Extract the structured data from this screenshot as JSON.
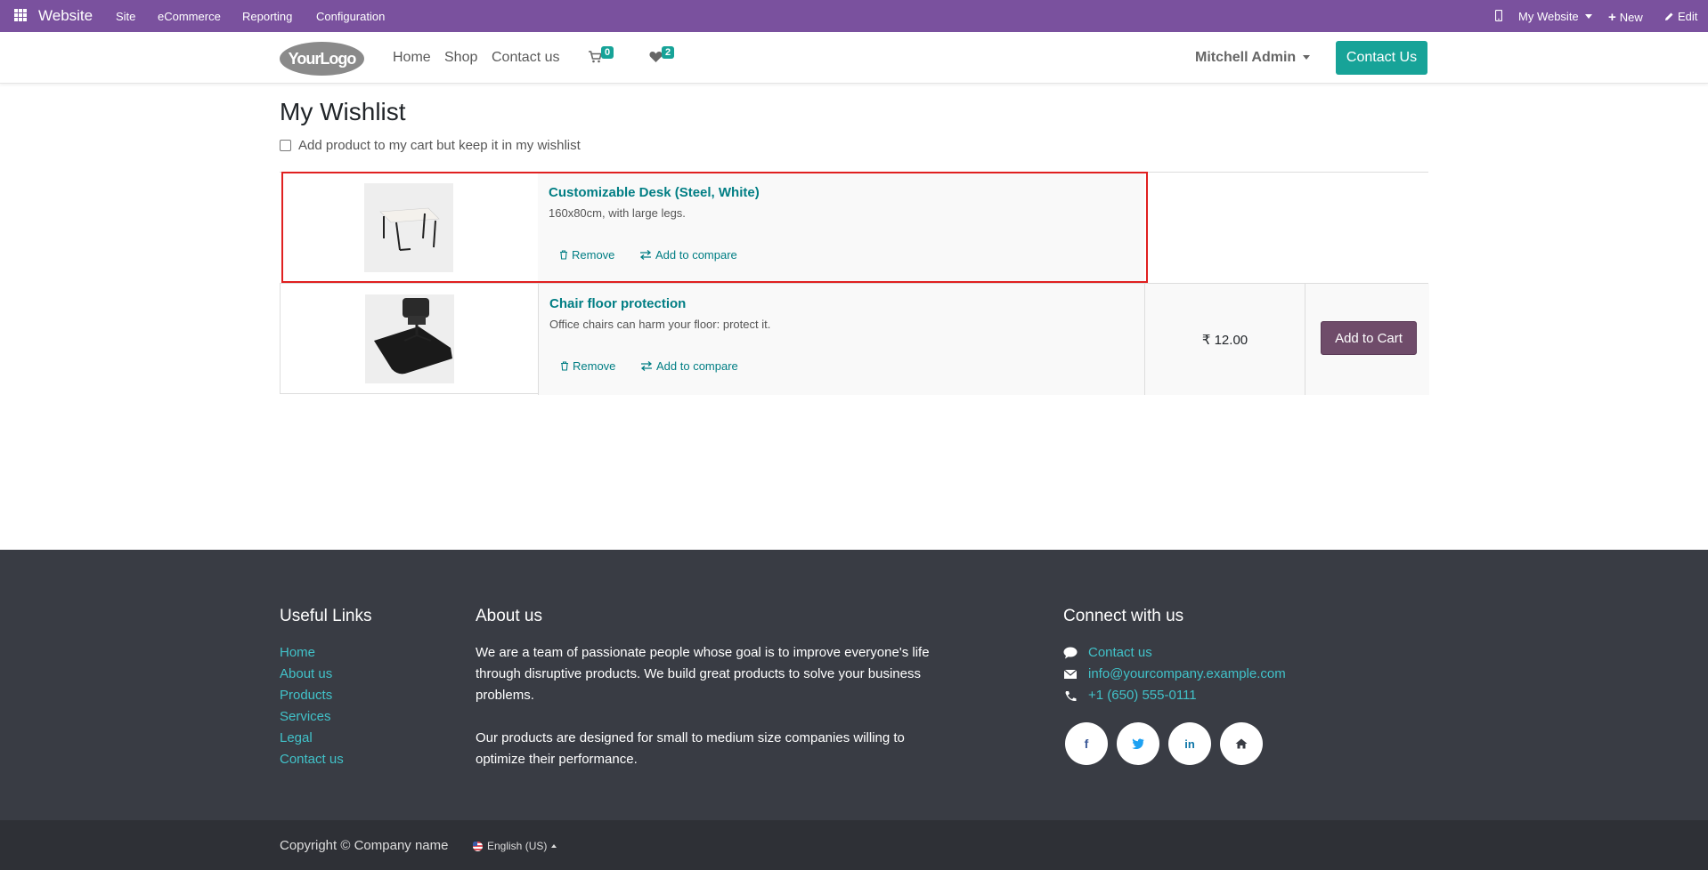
{
  "topbar": {
    "brand": "Website",
    "menu": [
      "Site",
      "eCommerce",
      "Reporting",
      "Configuration"
    ],
    "my_website": "My Website",
    "new": "New",
    "edit": "Edit"
  },
  "header": {
    "logo_text": "YourLogo",
    "nav": [
      "Home",
      "Shop",
      "Contact us"
    ],
    "cart_count": "0",
    "wishlist_count": "2",
    "user": "Mitchell Admin",
    "contact_button": "Contact Us"
  },
  "main": {
    "title": "My Wishlist",
    "checkbox_label": "Add product to my cart but keep it in my wishlist",
    "items": [
      {
        "name": "Customizable Desk (Steel, White)",
        "description": "160x80cm, with large legs.",
        "remove": "Remove",
        "compare": "Add to compare",
        "price": "",
        "cart_button": ""
      },
      {
        "name": "Chair floor protection",
        "description": "Office chairs can harm your floor: protect it.",
        "remove": "Remove",
        "compare": "Add to compare",
        "price": "₹ 12.00",
        "cart_button": "Add to Cart"
      }
    ]
  },
  "footer": {
    "useful_links_title": "Useful Links",
    "useful_links": [
      "Home",
      "About us",
      "Products",
      "Services",
      "Legal",
      "Contact us"
    ],
    "about_title": "About us",
    "about_p1": "We are a team of passionate people whose goal is to improve everyone's life through disruptive products. We build great products to solve your business problems.",
    "about_p2": "Our products are designed for small to medium size companies willing to optimize their performance.",
    "connect_title": "Connect with us",
    "contact_us": "Contact us",
    "email": "info@yourcompany.example.com",
    "phone": "+1 (650) 555-0111",
    "copyright": "Copyright © Company name",
    "language": "English (US)"
  },
  "colors": {
    "topbar": "#7a519e",
    "accent": "#17a398",
    "link": "#017e84",
    "cart_button": "#6f4c6a",
    "footer": "#393c44",
    "highlight": "#e02020"
  }
}
